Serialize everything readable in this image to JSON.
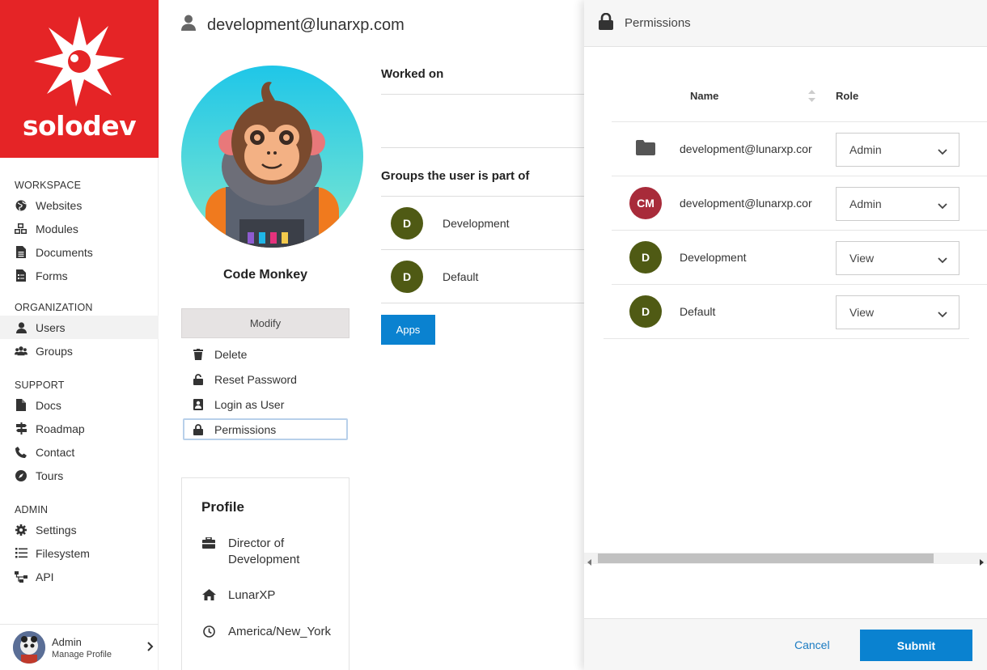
{
  "brand": {
    "name": "solodev",
    "color": "#e52426"
  },
  "sidebar": {
    "sections": [
      {
        "title": "WORKSPACE",
        "items": [
          {
            "label": "Websites",
            "icon": "globe-icon"
          },
          {
            "label": "Modules",
            "icon": "cubes-icon"
          },
          {
            "label": "Documents",
            "icon": "document-icon"
          },
          {
            "label": "Forms",
            "icon": "form-icon"
          }
        ]
      },
      {
        "title": "ORGANIZATION",
        "items": [
          {
            "label": "Users",
            "icon": "user-icon",
            "active": true
          },
          {
            "label": "Groups",
            "icon": "users-icon"
          }
        ]
      },
      {
        "title": "SUPPORT",
        "items": [
          {
            "label": "Docs",
            "icon": "file-icon"
          },
          {
            "label": "Roadmap",
            "icon": "signpost-icon"
          },
          {
            "label": "Contact",
            "icon": "phone-icon"
          },
          {
            "label": "Tours",
            "icon": "compass-icon"
          }
        ]
      },
      {
        "title": "ADMIN",
        "items": [
          {
            "label": "Settings",
            "icon": "gear-icon"
          },
          {
            "label": "Filesystem",
            "icon": "list-icon"
          },
          {
            "label": "API",
            "icon": "sitemap-icon"
          }
        ]
      }
    ],
    "footer": {
      "name": "Admin",
      "sub": "Manage Profile"
    }
  },
  "user": {
    "email": "development@lunarxp.com",
    "display_name": "Code Monkey",
    "modify_label": "Modify",
    "actions": [
      {
        "label": "Delete",
        "icon": "trash-icon"
      },
      {
        "label": "Reset Password",
        "icon": "unlock-icon"
      },
      {
        "label": "Login as User",
        "icon": "id-badge-icon"
      },
      {
        "label": "Permissions",
        "icon": "lock-icon"
      }
    ],
    "profile": {
      "title": "Profile",
      "job_line1": "Director of",
      "job_line2": "Development",
      "company": "LunarXP",
      "timezone": "America/New_York"
    }
  },
  "main": {
    "worked_on_title": "Worked on",
    "groups_title": "Groups the user is part of",
    "groups": [
      {
        "initial": "D",
        "name": "Development",
        "color": "#4f5a14"
      },
      {
        "initial": "D",
        "name": "Default",
        "color": "#4f5a14"
      }
    ],
    "apps_label": "Apps"
  },
  "panel": {
    "title": "Permissions",
    "col_name": "Name",
    "col_role": "Role",
    "rows": [
      {
        "type": "folder",
        "name": "development@lunarxp.cor",
        "role": "Admin"
      },
      {
        "type": "avatar",
        "initial": "CM",
        "color": "#a82b3a",
        "name": "development@lunarxp.cor",
        "role": "Admin"
      },
      {
        "type": "avatar",
        "initial": "D",
        "color": "#4f5a14",
        "name": "Development",
        "role": "View"
      },
      {
        "type": "avatar",
        "initial": "D",
        "color": "#4f5a14",
        "name": "Default",
        "role": "View"
      }
    ],
    "cancel_label": "Cancel",
    "submit_label": "Submit"
  }
}
